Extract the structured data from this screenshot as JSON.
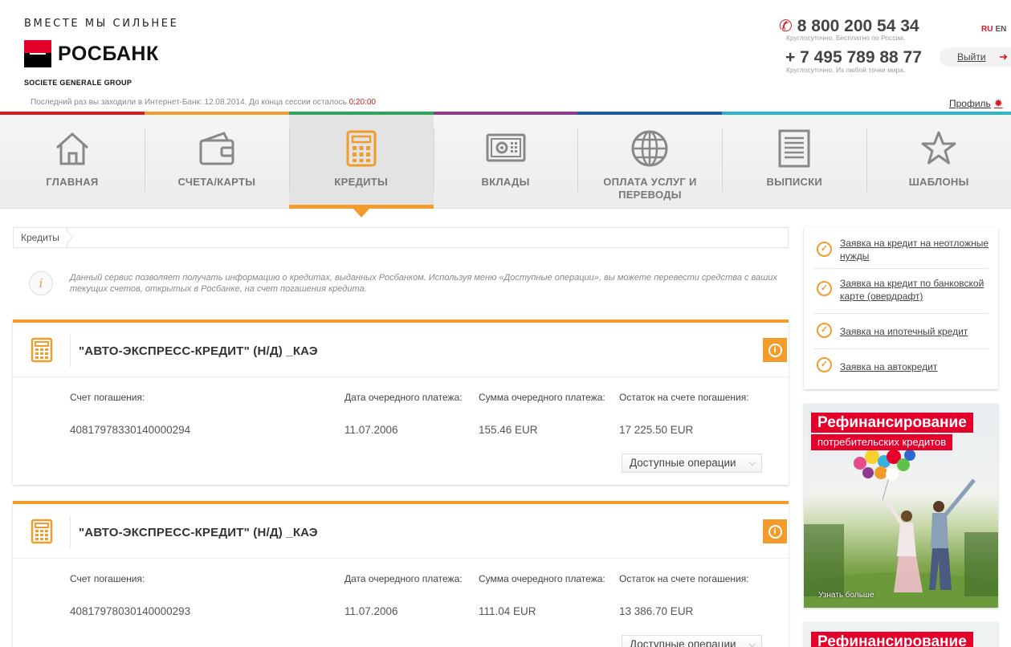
{
  "header": {
    "tagline": "ВМЕСТЕ МЫ СИЛЬНЕЕ",
    "logo_text": "РОСБАНК",
    "group": "SOCIETE GENERALE GROUP",
    "session_prefix": "Последний раз вы заходили в Интернет-Банк: 12.08.2014.  До конца сессии осталось ",
    "session_timer": "0:20:00",
    "phone1": "8 800 200 54 34",
    "phone1_note": "Круглосуточно. Бесплатно по России.",
    "phone2": "+ 7 495 789 88 77",
    "phone2_note": "Круглосуточно. Из любой точки мира.",
    "lang_ru": "RU",
    "lang_en": "EN",
    "logout": "Выйти",
    "profile": "Профиль"
  },
  "colors": {
    "accent": "#f39c2c",
    "brand_red": "#e4002b",
    "strip": [
      "#d71920",
      "#f39c2c",
      "#2aa857",
      "#8e3b8f",
      "#1a5ea8",
      "#2bb7c4"
    ]
  },
  "nav": {
    "items": [
      {
        "label": "ГЛАВНАЯ",
        "icon": "home-icon"
      },
      {
        "label": "СЧЕТА/КАРТЫ",
        "icon": "wallet-icon"
      },
      {
        "label": "КРЕДИТЫ",
        "icon": "calculator-icon",
        "active": true
      },
      {
        "label": "ВКЛАДЫ",
        "icon": "safe-icon"
      },
      {
        "label": "ОПЛАТА УСЛУГ И ПЕРЕВОДЫ",
        "icon": "globe-icon"
      },
      {
        "label": "ВЫПИСКИ",
        "icon": "document-icon"
      },
      {
        "label": "ШАБЛОНЫ",
        "icon": "star-icon"
      }
    ]
  },
  "breadcrumb": {
    "item": "Кредиты"
  },
  "info": {
    "text": "Данный сервис позволяет получать информацию о кредитах, выданных Росбанком. Используя меню «Доступные операции», вы можете перевести средства с ваших текущих счетов, открытых в Росбанке, на счет погашения кредита."
  },
  "columns": {
    "account": "Счет погашения:",
    "date": "Дата очередного платежа:",
    "amount": "Сумма очередного платежа:",
    "balance": "Остаток на счете погашения:"
  },
  "credits": [
    {
      "title": "\"АВТО-ЭКСПРЕСС-КРЕДИТ\" (Н/Д) _КАЭ",
      "account": "40817978330140000294",
      "date": "11.07.2006",
      "amount": "155.46 EUR",
      "balance": "17 225.50 EUR",
      "ops": "Доступные операции"
    },
    {
      "title": "\"АВТО-ЭКСПРЕСС-КРЕДИТ\" (Н/Д) _КАЭ",
      "account": "40817978030140000293",
      "date": "11.07.2006",
      "amount": "111.04 EUR",
      "balance": "13 386.70 EUR",
      "ops": "Доступные операции"
    }
  ],
  "sidebar": {
    "links": [
      "Заявка на кредит на неотложные нужды",
      "Заявка на кредит по банковской карте (овердрафт)",
      "Заявка на ипотечный кредит",
      "Заявка на автокредит"
    ],
    "banner_title": "Рефинансирование",
    "banner_sub": "потребительских кредитов",
    "banner_more": "Узнать больше"
  }
}
